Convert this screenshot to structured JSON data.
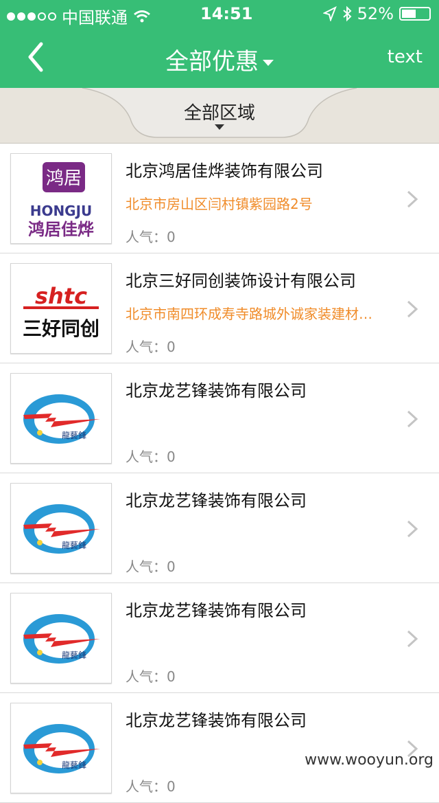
{
  "status_bar": {
    "carrier": "中国联通",
    "time": "14:51",
    "battery": "52%",
    "battery_level": 0.52
  },
  "nav": {
    "title": "全部优惠",
    "right_button": "text"
  },
  "filter": {
    "region_label": "全部区域"
  },
  "companies": [
    {
      "name": "北京鸿居佳烨装饰有限公司",
      "address": "北京市房山区闫村镇紫园路2号",
      "popularity": "人气：0",
      "logo": "hongju-logo"
    },
    {
      "name": "北京三好同创装饰设计有限公司",
      "address": "北京市南四环成寿寺路城外诚家装建材…",
      "popularity": "人气：0",
      "logo": "shtc-logo"
    },
    {
      "name": "北京龙艺锋装饰有限公司",
      "address": "",
      "popularity": "人气：0",
      "logo": "longyifeng-logo"
    },
    {
      "name": "北京龙艺锋装饰有限公司",
      "address": "",
      "popularity": "人气：0",
      "logo": "longyifeng-logo"
    },
    {
      "name": "北京龙艺锋装饰有限公司",
      "address": "",
      "popularity": "人气：0",
      "logo": "longyifeng-logo"
    },
    {
      "name": "北京龙艺锋装饰有限公司",
      "address": "",
      "popularity": "人气：0",
      "logo": "longyifeng-logo"
    }
  ],
  "logo_text": {
    "hongju_cn": "鸿居",
    "hongju_en": "HONGJU",
    "hongju_cn_full": "鸿居佳烨",
    "shtc_en": "shtc",
    "shtc_cn": "三好同创",
    "lyf_cn": "龍藝鋒"
  },
  "watermark": "www.wooyun.org",
  "colors": {
    "header": "#37be76",
    "address": "#f08c2a",
    "filter_bar": "#e8e4dc"
  }
}
